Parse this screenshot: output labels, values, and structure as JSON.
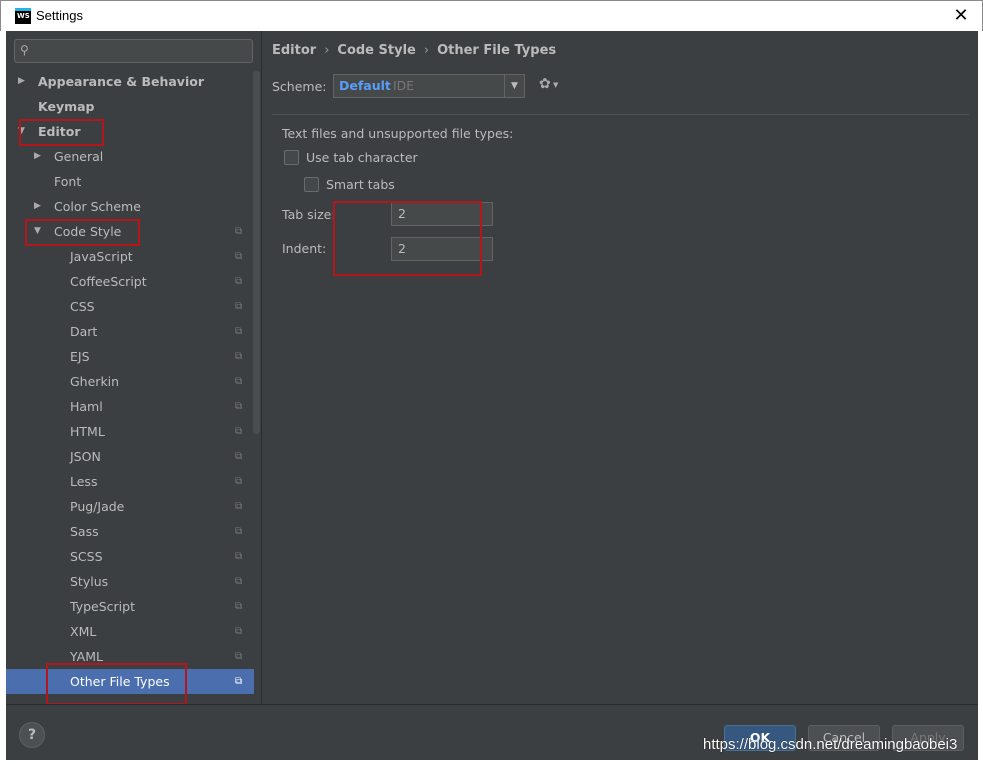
{
  "window": {
    "title": "Settings",
    "logo_text": "WS",
    "close_glyph": "✕"
  },
  "search": {
    "placeholder": "",
    "icon": "search-icon"
  },
  "tree": [
    {
      "label": "Appearance & Behavior",
      "arrow": "▶",
      "level": 0,
      "bold": true,
      "copy": false
    },
    {
      "label": "Keymap",
      "arrow": "",
      "level": 0,
      "bold": true,
      "copy": false
    },
    {
      "label": "Editor",
      "arrow": "▼",
      "level": 0,
      "bold": true,
      "copy": false
    },
    {
      "label": "General",
      "arrow": "▶",
      "level": 1,
      "bold": false,
      "copy": false
    },
    {
      "label": "Font",
      "arrow": "",
      "level": 1,
      "bold": false,
      "copy": false
    },
    {
      "label": "Color Scheme",
      "arrow": "▶",
      "level": 1,
      "bold": false,
      "copy": false
    },
    {
      "label": "Code Style",
      "arrow": "▼",
      "level": 1,
      "bold": false,
      "copy": true
    },
    {
      "label": "JavaScript",
      "arrow": "",
      "level": 2,
      "bold": false,
      "copy": true
    },
    {
      "label": "CoffeeScript",
      "arrow": "",
      "level": 2,
      "bold": false,
      "copy": true
    },
    {
      "label": "CSS",
      "arrow": "",
      "level": 2,
      "bold": false,
      "copy": true
    },
    {
      "label": "Dart",
      "arrow": "",
      "level": 2,
      "bold": false,
      "copy": true
    },
    {
      "label": "EJS",
      "arrow": "",
      "level": 2,
      "bold": false,
      "copy": true
    },
    {
      "label": "Gherkin",
      "arrow": "",
      "level": 2,
      "bold": false,
      "copy": true
    },
    {
      "label": "Haml",
      "arrow": "",
      "level": 2,
      "bold": false,
      "copy": true
    },
    {
      "label": "HTML",
      "arrow": "",
      "level": 2,
      "bold": false,
      "copy": true
    },
    {
      "label": "JSON",
      "arrow": "",
      "level": 2,
      "bold": false,
      "copy": true
    },
    {
      "label": "Less",
      "arrow": "",
      "level": 2,
      "bold": false,
      "copy": true
    },
    {
      "label": "Pug/Jade",
      "arrow": "",
      "level": 2,
      "bold": false,
      "copy": true
    },
    {
      "label": "Sass",
      "arrow": "",
      "level": 2,
      "bold": false,
      "copy": true
    },
    {
      "label": "SCSS",
      "arrow": "",
      "level": 2,
      "bold": false,
      "copy": true
    },
    {
      "label": "Stylus",
      "arrow": "",
      "level": 2,
      "bold": false,
      "copy": true
    },
    {
      "label": "TypeScript",
      "arrow": "",
      "level": 2,
      "bold": false,
      "copy": true
    },
    {
      "label": "XML",
      "arrow": "",
      "level": 2,
      "bold": false,
      "copy": true
    },
    {
      "label": "YAML",
      "arrow": "",
      "level": 2,
      "bold": false,
      "copy": true
    },
    {
      "label": "Other File Types",
      "arrow": "",
      "level": 2,
      "bold": false,
      "copy": true,
      "selected": true
    }
  ],
  "breadcrumb": {
    "part1": "Editor",
    "part2": "Code Style",
    "part3": "Other File Types",
    "sep": "›"
  },
  "scheme": {
    "label": "Scheme:",
    "name": "Default",
    "sub": "IDE",
    "dropdown_glyph": "▼",
    "gear_glyph": "✿",
    "gear_caret": "▼"
  },
  "panel": {
    "title": "Text files and unsupported file types:",
    "use_tab_label": "Use tab character",
    "smart_tabs_label": "Smart tabs",
    "tab_size_label": "Tab size:",
    "tab_size_value": "2",
    "indent_label": "Indent:",
    "indent_value": "2"
  },
  "footer": {
    "help": "?",
    "ok": "OK",
    "cancel": "Cancel",
    "apply": "Apply"
  },
  "watermark": "https://blog.csdn.net/dreamingbaobei3",
  "colors": {
    "background": "#3c3f41",
    "selection": "#4b6eaf",
    "accent": "#589df6",
    "highlight_box": "#b3161b"
  }
}
